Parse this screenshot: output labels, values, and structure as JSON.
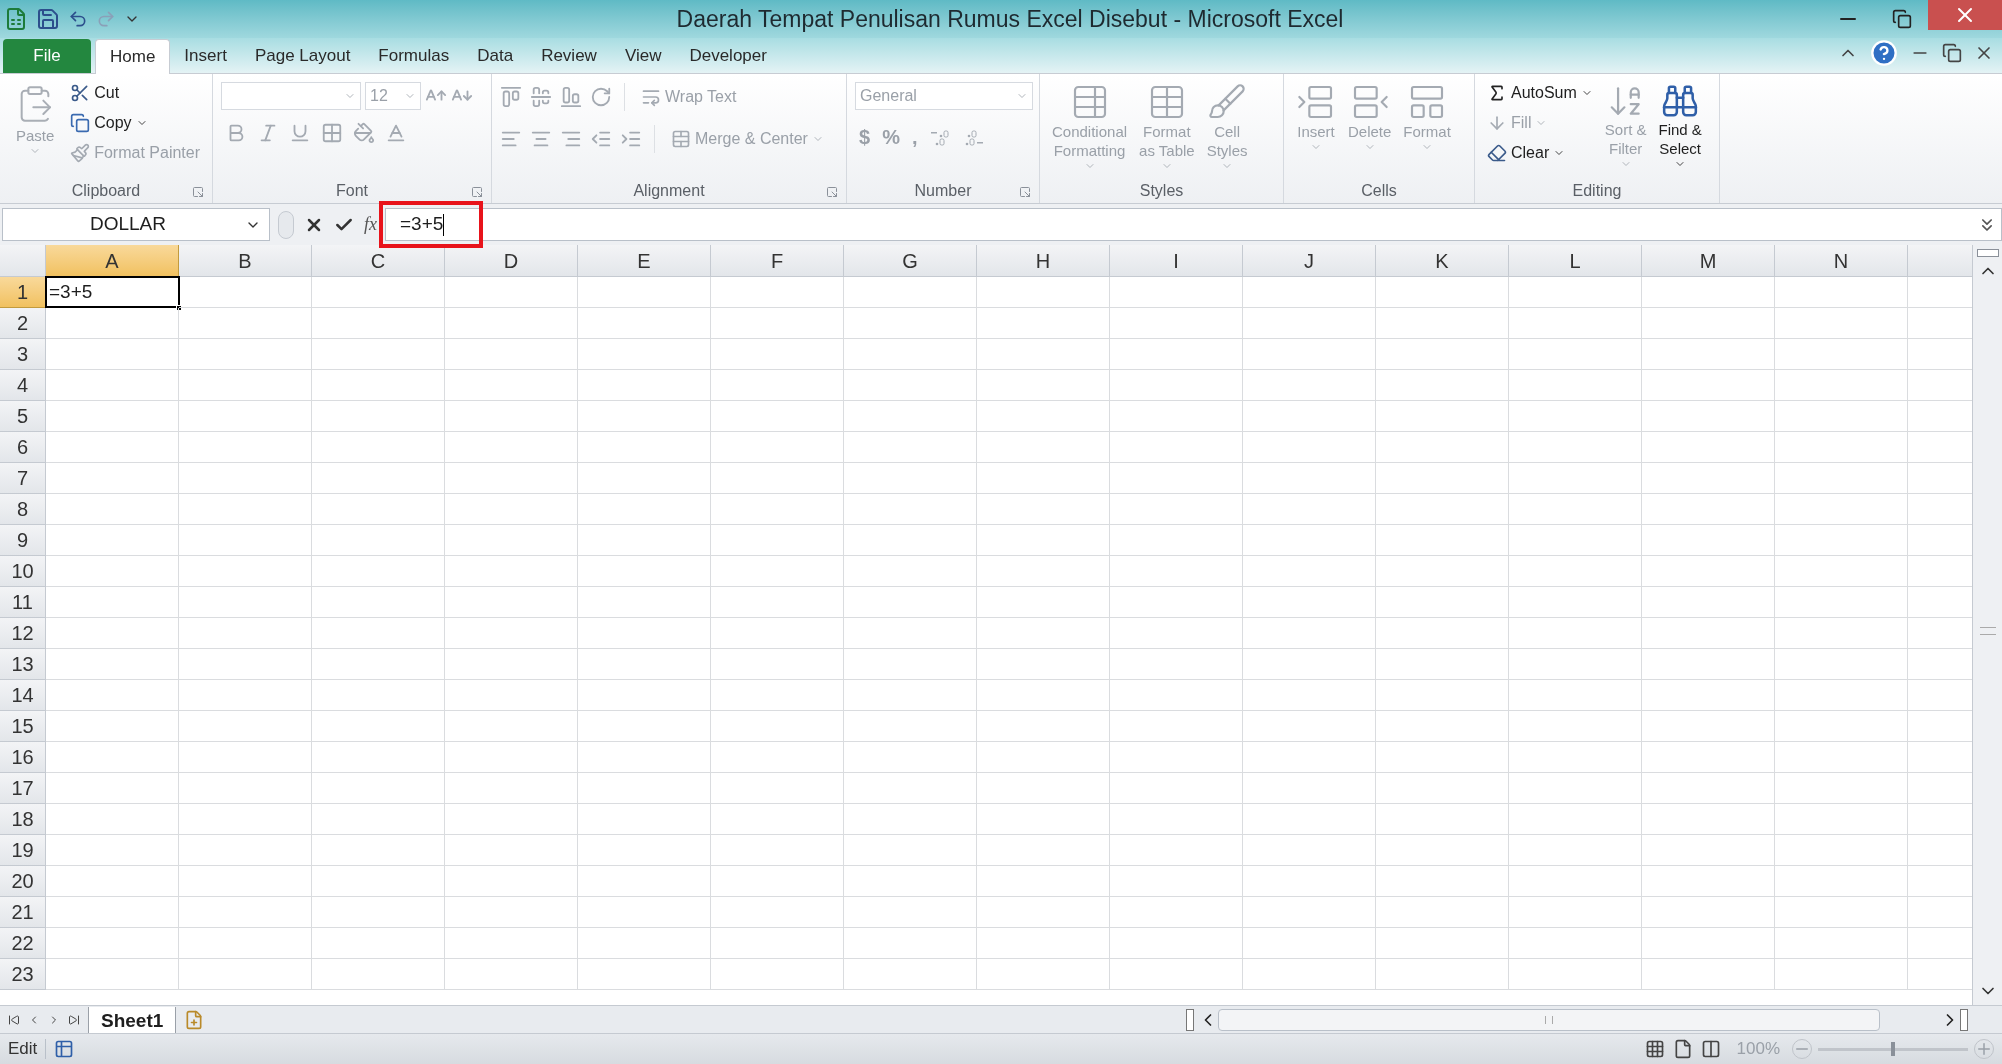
{
  "window": {
    "title": "Daerah Tempat Penulisan Rumus Excel Disebut - Microsoft Excel"
  },
  "ribbon_tabs": [
    {
      "label": "File",
      "kind": "file",
      "selected": false
    },
    {
      "label": "Home",
      "kind": "tab",
      "selected": true
    },
    {
      "label": "Insert",
      "kind": "tab",
      "selected": false
    },
    {
      "label": "Page Layout",
      "kind": "tab",
      "selected": false
    },
    {
      "label": "Formulas",
      "kind": "tab",
      "selected": false
    },
    {
      "label": "Data",
      "kind": "tab",
      "selected": false
    },
    {
      "label": "Review",
      "kind": "tab",
      "selected": false
    },
    {
      "label": "View",
      "kind": "tab",
      "selected": false
    },
    {
      "label": "Developer",
      "kind": "tab",
      "selected": false
    }
  ],
  "ribbon_groups": [
    {
      "kind": "clipboard",
      "title": "Clipboard",
      "items": [
        {
          "lines": [
            "Paste"
          ],
          "disabled": true
        },
        {
          "lines": [
            "Cut"
          ],
          "disabled": false
        },
        {
          "lines": [
            "Copy"
          ],
          "disabled": false
        },
        {
          "lines": [
            "Format Painter"
          ],
          "disabled": true
        }
      ]
    },
    {
      "kind": "font",
      "title": "Font",
      "font_size": "12",
      "disabled": true
    },
    {
      "kind": "alignment",
      "title": "Alignment",
      "items": [
        {
          "lines": [
            "Wrap Text"
          ],
          "disabled": true
        },
        {
          "lines": [
            "Merge & Center"
          ],
          "disabled": true
        }
      ]
    },
    {
      "kind": "number",
      "title": "Number",
      "format": "General",
      "symbols": [
        "$",
        "%",
        ","
      ],
      "disabled": true
    },
    {
      "kind": "styles",
      "title": "Styles",
      "items": [
        {
          "lines": [
            "Conditional",
            "Formatting"
          ],
          "disabled": true
        },
        {
          "lines": [
            "Format",
            "as Table"
          ],
          "disabled": true
        },
        {
          "lines": [
            "Cell",
            "Styles"
          ],
          "disabled": true
        }
      ]
    },
    {
      "kind": "cells",
      "title": "Cells",
      "items": [
        {
          "lines": [
            "Insert"
          ],
          "disabled": true
        },
        {
          "lines": [
            "Delete"
          ],
          "disabled": true
        },
        {
          "lines": [
            "Format"
          ],
          "disabled": true
        }
      ]
    },
    {
      "kind": "editing",
      "title": "Editing",
      "items": [
        {
          "lines": [
            "AutoSum"
          ],
          "disabled": false
        },
        {
          "lines": [
            "Fill"
          ],
          "disabled": true
        },
        {
          "lines": [
            "Clear"
          ],
          "disabled": false
        },
        {
          "lines": [
            "Sort &",
            "Filter"
          ],
          "disabled": true
        },
        {
          "lines": [
            "Find &",
            "Select"
          ],
          "disabled": false
        }
      ]
    }
  ],
  "formula_bar": {
    "name_box": "DOLLAR",
    "function_label": "fx",
    "formula": "=3+5"
  },
  "grid": {
    "columns": [
      {
        "label": "A",
        "selected": true
      },
      {
        "label": "B",
        "selected": false
      },
      {
        "label": "C",
        "selected": false
      },
      {
        "label": "D",
        "selected": false
      },
      {
        "label": "E",
        "selected": false
      },
      {
        "label": "F",
        "selected": false
      },
      {
        "label": "G",
        "selected": false
      },
      {
        "label": "H",
        "selected": false
      },
      {
        "label": "I",
        "selected": false
      },
      {
        "label": "J",
        "selected": false
      },
      {
        "label": "K",
        "selected": false
      },
      {
        "label": "L",
        "selected": false
      },
      {
        "label": "M",
        "selected": false
      },
      {
        "label": "N",
        "selected": false
      }
    ],
    "rows": [
      {
        "label": "1",
        "selected": true,
        "cells": [
          "=3+5"
        ]
      },
      {
        "label": "2",
        "selected": false
      },
      {
        "label": "3",
        "selected": false
      },
      {
        "label": "4",
        "selected": false
      },
      {
        "label": "5",
        "selected": false
      },
      {
        "label": "6",
        "selected": false
      },
      {
        "label": "7",
        "selected": false
      },
      {
        "label": "8",
        "selected": false
      },
      {
        "label": "9",
        "selected": false
      },
      {
        "label": "10",
        "selected": false
      },
      {
        "label": "11",
        "selected": false
      },
      {
        "label": "12",
        "selected": false
      },
      {
        "label": "13",
        "selected": false
      },
      {
        "label": "14",
        "selected": false
      },
      {
        "label": "15",
        "selected": false
      },
      {
        "label": "16",
        "selected": false
      },
      {
        "label": "17",
        "selected": false
      },
      {
        "label": "18",
        "selected": false
      },
      {
        "label": "19",
        "selected": false
      },
      {
        "label": "20",
        "selected": false
      },
      {
        "label": "21",
        "selected": false
      },
      {
        "label": "22",
        "selected": false
      },
      {
        "label": "23",
        "selected": false
      }
    ]
  },
  "sheet_tabs": [
    {
      "label": "Sheet1",
      "selected": true
    }
  ],
  "status_bar": {
    "mode": "Edit",
    "zoom": "100%",
    "zoom_slider": {
      "level": 0.5
    }
  }
}
